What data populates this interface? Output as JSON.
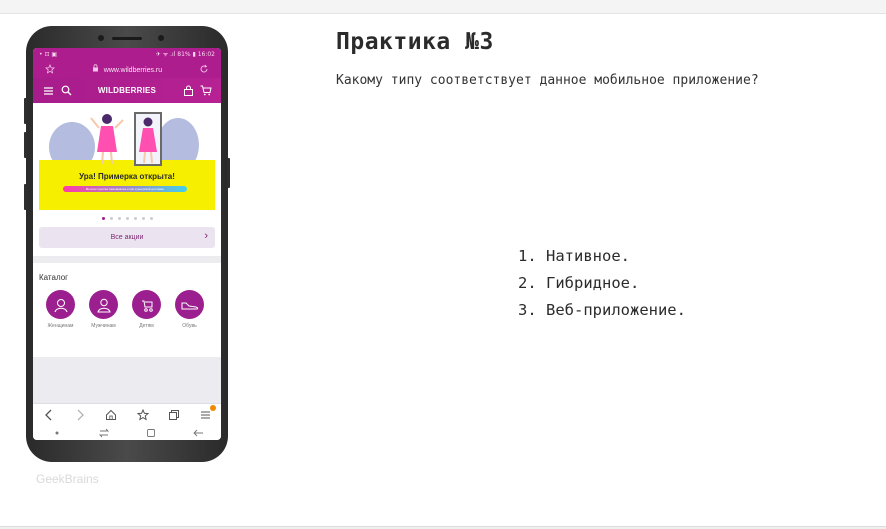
{
  "slide": {
    "title": "Практика №3",
    "question": "Какому типу соответствует данное мобильное приложение?",
    "options": [
      "1. Нативное.",
      "2. Гибридное.",
      "3. Веб-приложение."
    ],
    "watermark": "GeekBrains"
  },
  "phone": {
    "status": {
      "left": "• ⊡ ▣",
      "right": "✈ ᯤ .ıl 81% ▮ 16:02"
    },
    "url": "www.wildberries.ru",
    "brand": "WILDBERRIES",
    "banner": {
      "title": "Ура! Примерка открыта!",
      "subtitle": "Во всех пунктах самовывоза и при курьерской доставке"
    },
    "carousel": {
      "count": 7,
      "active": 0
    },
    "promo_button": "Все акции",
    "catalog": {
      "title": "Каталог",
      "items": [
        "Женщинам",
        "Мужчинам",
        "Детям",
        "Обувь"
      ]
    },
    "colors": {
      "brand": "#ad1d8e",
      "banner": "#f6f000",
      "badge": "#f08a00"
    },
    "icons": {
      "url_bar": [
        "star-icon",
        "lock-icon",
        "reload-icon"
      ],
      "nav": [
        "menu-icon",
        "search-icon",
        "profile-icon",
        "cart-icon"
      ],
      "browser": [
        "back-icon",
        "forward-icon",
        "home-icon",
        "bookmark-icon",
        "tabs-icon",
        "browser-menu-icon"
      ],
      "android": [
        "dot-icon",
        "recents-icon",
        "android-home-icon",
        "android-back-icon"
      ]
    }
  }
}
